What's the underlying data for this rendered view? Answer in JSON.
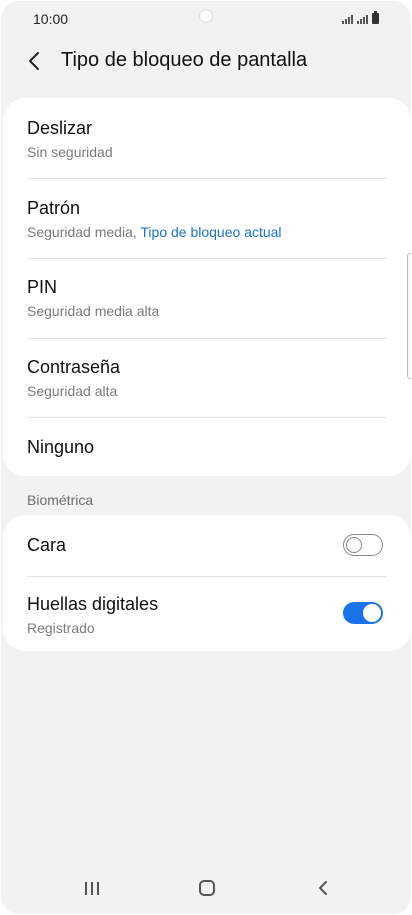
{
  "status_bar": {
    "time": "10:00"
  },
  "header": {
    "title": "Tipo de bloqueo de pantalla"
  },
  "lock_options": [
    {
      "title": "Deslizar",
      "subtitle": "Sin seguridad"
    },
    {
      "title": "Patrón",
      "subtitle": "Seguridad media,",
      "subtitle_accent": "Tipo de bloqueo actual"
    },
    {
      "title": "PIN",
      "subtitle": "Seguridad media alta"
    },
    {
      "title": "Contraseña",
      "subtitle": "Seguridad alta"
    },
    {
      "title": "Ninguno"
    }
  ],
  "biometrics": {
    "section_label": "Biométrica",
    "items": [
      {
        "title": "Cara",
        "toggle": "off"
      },
      {
        "title": "Huellas digitales",
        "subtitle": "Registrado",
        "toggle": "on"
      }
    ]
  },
  "colors": {
    "accent": "#1a73e8",
    "link": "#1a73c8",
    "background": "#f2f2f2"
  },
  "icons": {
    "back": "chevron-left-icon",
    "nav_recents": "recents-icon",
    "nav_home": "home-icon",
    "nav_back": "back-icon"
  }
}
